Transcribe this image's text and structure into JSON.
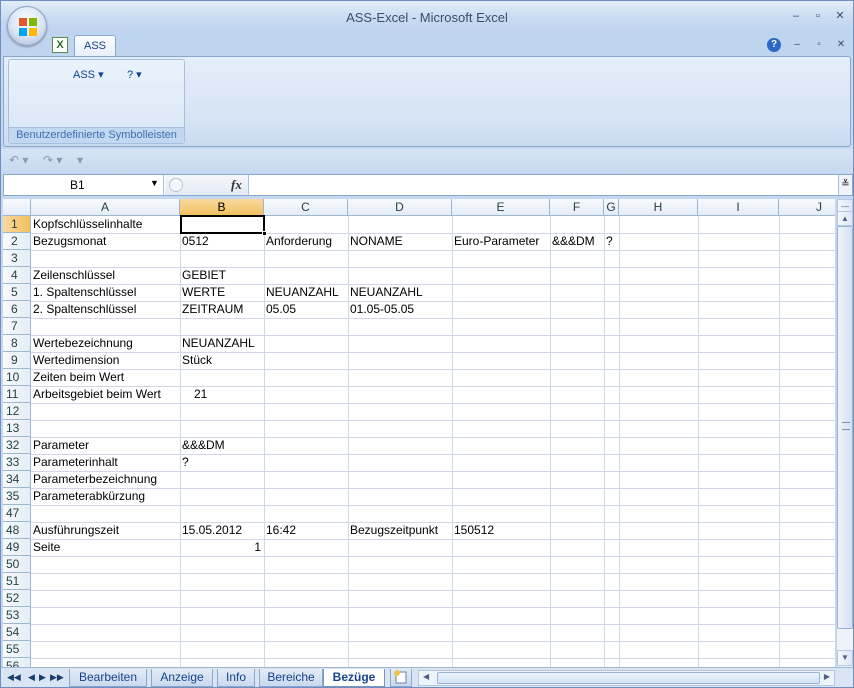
{
  "window": {
    "title": "ASS-Excel - Microsoft Excel"
  },
  "window_controls": {
    "minimize": "–",
    "restore": "▫",
    "close": "✕"
  },
  "ribbon": {
    "tab_label": "ASS",
    "app_icon_letter": "X",
    "help": "?",
    "buttons": [
      {
        "label": "ASS ▾"
      },
      {
        "label": "? ▾"
      }
    ],
    "group_label": "Benutzerdefinierte Symbolleisten"
  },
  "qat": {
    "undo": "↶ ▾",
    "redo": "↷ ▾",
    "customize": "▾"
  },
  "formula_bar": {
    "name_box": "B1",
    "fx": "fx",
    "content": ""
  },
  "selected": {
    "cell": "B1",
    "column": "B",
    "row": "1"
  },
  "columns": [
    "A",
    "B",
    "C",
    "D",
    "E",
    "F",
    "G",
    "H",
    "I",
    "J"
  ],
  "rows": [
    "1",
    "2",
    "3",
    "4",
    "5",
    "6",
    "7",
    "8",
    "9",
    "10",
    "11",
    "12",
    "13",
    "32",
    "33",
    "34",
    "35",
    "47",
    "48",
    "49",
    "50",
    "51",
    "52",
    "53",
    "54",
    "55",
    "56"
  ],
  "cells": {
    "r1": {
      "A": "Kopfschlüsselinhalte",
      "B": "",
      "C": "",
      "D": "",
      "E": ""
    },
    "r2": {
      "A": "Bezugsmonat",
      "B": "0512",
      "C": "Anforderung",
      "D": "NONAME",
      "E": "Euro-Parameter",
      "F": "&&&DM",
      "G": "?"
    },
    "r4": {
      "A": "Zeilenschlüssel",
      "B": "GEBIET"
    },
    "r5": {
      "A": "1. Spaltenschlüssel",
      "B": "WERTE",
      "C": "NEUANZAHL",
      "D": "NEUANZAHL"
    },
    "r6": {
      "A": "2. Spaltenschlüssel",
      "B": "ZEITRAUM",
      "C": "05.05",
      "D": "01.05-05.05"
    },
    "r8": {
      "A": "Wertebezeichnung",
      "B": "NEUANZAHL"
    },
    "r9": {
      "A": "Wertedimension",
      "B": "Stück"
    },
    "r10": {
      "A": "Zeiten beim Wert"
    },
    "r11": {
      "A": "Arbeitsgebiet beim Wert",
      "B": "21"
    },
    "r32": {
      "A": "Parameter",
      "B": "&&&DM"
    },
    "r33": {
      "A": "Parameterinhalt",
      "B": "?"
    },
    "r34": {
      "A": "Parameterbezeichnung"
    },
    "r35": {
      "A": "Parameterabkürzung"
    },
    "r48": {
      "A": "Ausführungszeit",
      "B": "15.05.2012",
      "C": "16:42",
      "D": "Bezugszeitpunkt",
      "E": "150512"
    },
    "r49": {
      "A": "Seite",
      "B": "1"
    }
  },
  "sheet_tabs": [
    "Bearbeiten",
    "Anzeige",
    "Info",
    "Bereiche",
    "Bezüge"
  ],
  "active_sheet": "Bezüge",
  "sheet_nav": {
    "first": "◀◀",
    "prev": "◀",
    "next": "▶",
    "last": "▶▶"
  }
}
